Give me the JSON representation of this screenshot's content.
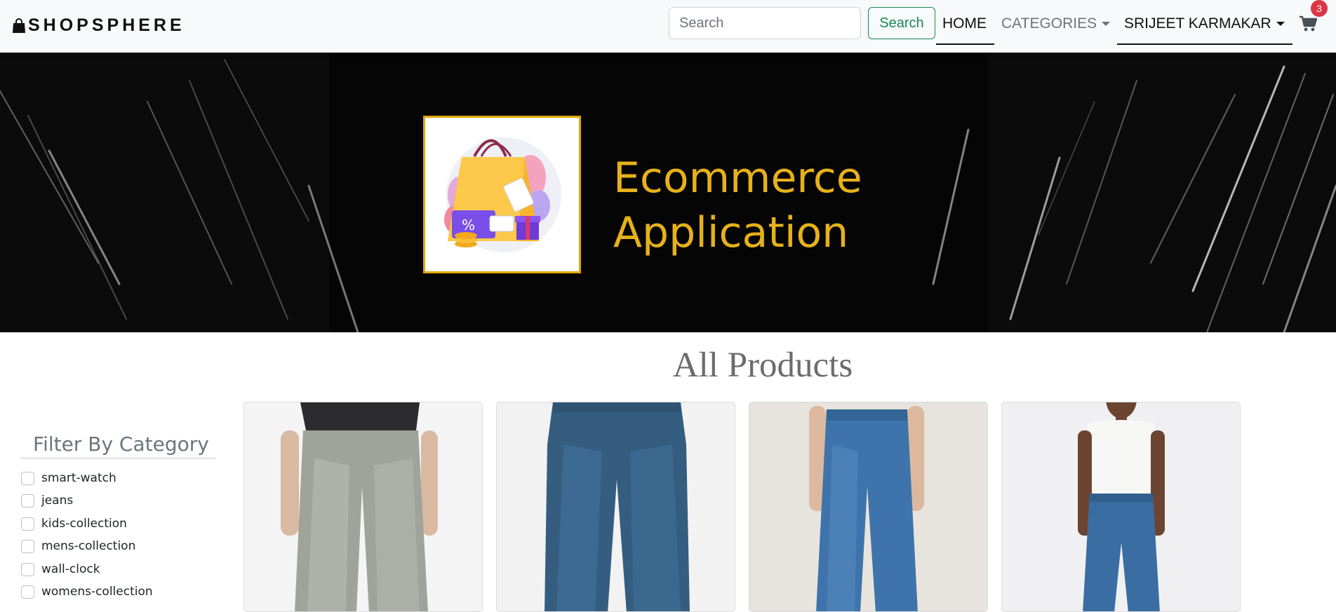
{
  "navbar": {
    "brand": "SHOPSPHERE",
    "brand_icon": "shopping-bag-icon",
    "search": {
      "placeholder": "Search",
      "value": "",
      "button_label": "Search"
    },
    "links": {
      "home": "HOME",
      "categories": "CATEGORIES",
      "user": "SRIJEET KARMAKAR"
    },
    "cart": {
      "icon": "cart-icon",
      "count": "3"
    }
  },
  "banner": {
    "line1": "Ecommerce",
    "line2": "Application",
    "text_color": "#e6b11a"
  },
  "main": {
    "title": "All Products"
  },
  "filter": {
    "title": "Filter By Category",
    "categories": [
      "smart-watch",
      "jeans",
      "kids-collection",
      "mens-collection",
      "wall-clock",
      "womens-collection"
    ]
  },
  "colors": {
    "success": "#198754",
    "badge": "#dc3545",
    "navbar_bg": "#f8f9fa"
  }
}
